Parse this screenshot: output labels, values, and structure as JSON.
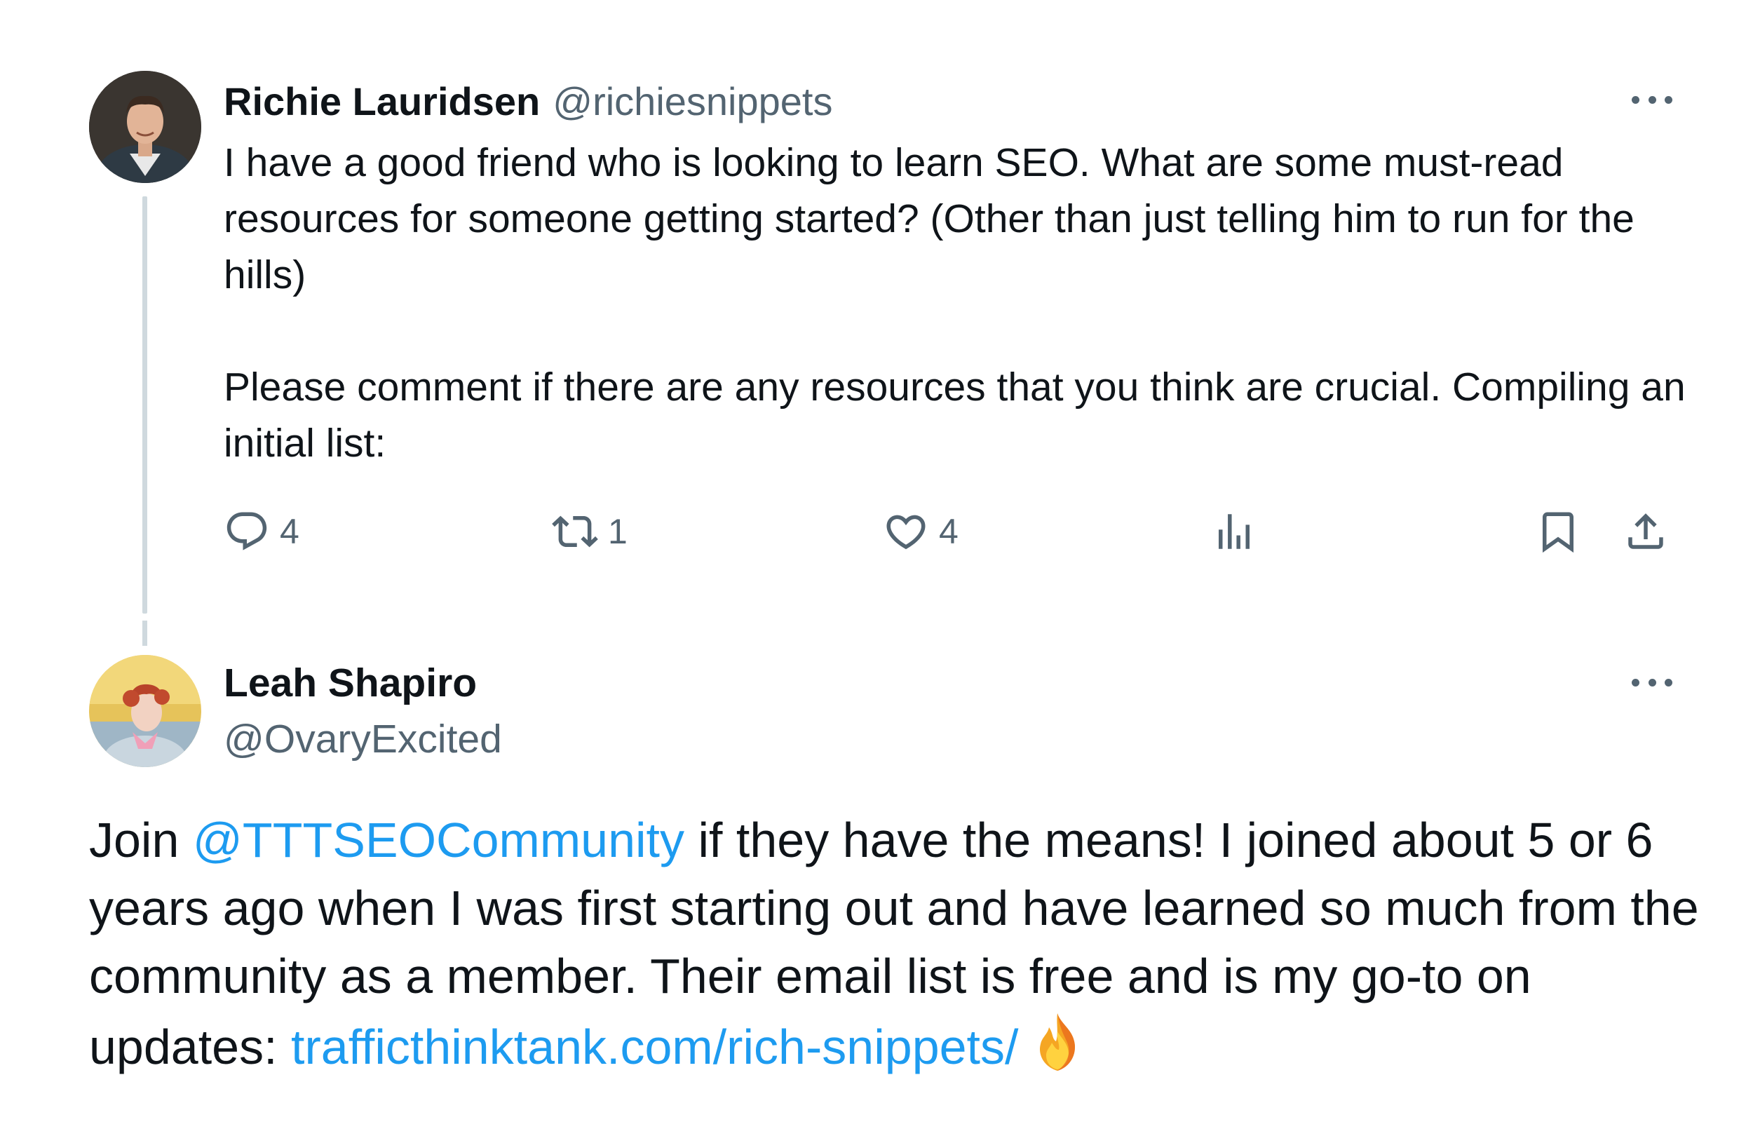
{
  "tweet": {
    "author": {
      "name": "Richie Lauridsen",
      "handle": "@richiesnippets"
    },
    "text": "I have a good friend who is looking to learn SEO. What are some must-read resources for someone getting started? (Other than just telling him to run for the hills)\n\nPlease comment if there are any resources that you think are crucial. Compiling an initial list:",
    "actions": {
      "replies": "4",
      "reposts": "1",
      "likes": "4"
    }
  },
  "reply": {
    "author": {
      "name": "Leah Shapiro",
      "handle": "@OvaryExcited"
    },
    "text_part1": "Join ",
    "mention": "@TTTSEOCommunity",
    "text_part2": " if they have the means! I joined about 5 or 6 years ago when I was first starting out and have learned so much from the community as a member. Their email list is free and is my go-to on updates: ",
    "link": "trafficthinktank.com/rich-snippets/",
    "emoji": "fire-emoji"
  },
  "colors": {
    "text": "#0f1419",
    "secondary": "#536471",
    "link": "#1d9bf0",
    "thread_line": "#cfd9de"
  },
  "icons": [
    "reply-icon",
    "repost-icon",
    "like-icon",
    "views-icon",
    "bookmark-icon",
    "share-icon",
    "more-icon",
    "fire-icon"
  ]
}
